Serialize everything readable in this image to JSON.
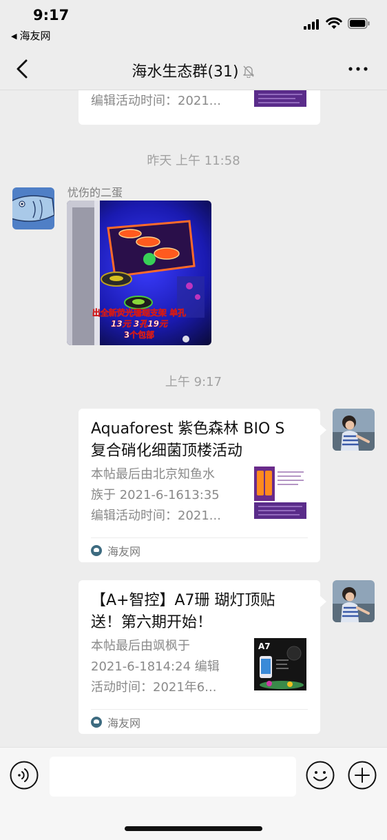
{
  "status_bar": {
    "time": "9:17",
    "back_app": "海友网"
  },
  "nav": {
    "title": "海水生态群(31)"
  },
  "top_card": {
    "desc_line": "编辑活动时间：2021..."
  },
  "timestamps": [
    "昨天 上午 11:58",
    "上午 9:17"
  ],
  "photo_message": {
    "sender": "忧伤的二蛋",
    "overlay_line1": "出全新荧光珊瑚支架 单孔",
    "overlay_line2": "13元 3孔19元",
    "overlay_line3": "3个包部"
  },
  "link_cards": [
    {
      "title_line1": "Aquaforest 紫色森林 BIO S",
      "title_line2": "复合硝化细菌顶楼活动",
      "desc_line1": "本帖最后由北京知鱼水",
      "desc_line2": "族于 2021-6-1613:35",
      "desc_line3": "编辑活动时间：2021...",
      "source": "海友网"
    },
    {
      "title_line1": "【A+智控】A7珊 瑚灯顶贴",
      "title_line2": "送！第六期开始！",
      "desc_line1": "本帖最后由飒枫于",
      "desc_line2": "2021-6-1814:24 编辑",
      "desc_line3": "活动时间：2021年6...",
      "source": "海友网",
      "thumb_label": "A7"
    }
  ],
  "input": {
    "value": ""
  }
}
